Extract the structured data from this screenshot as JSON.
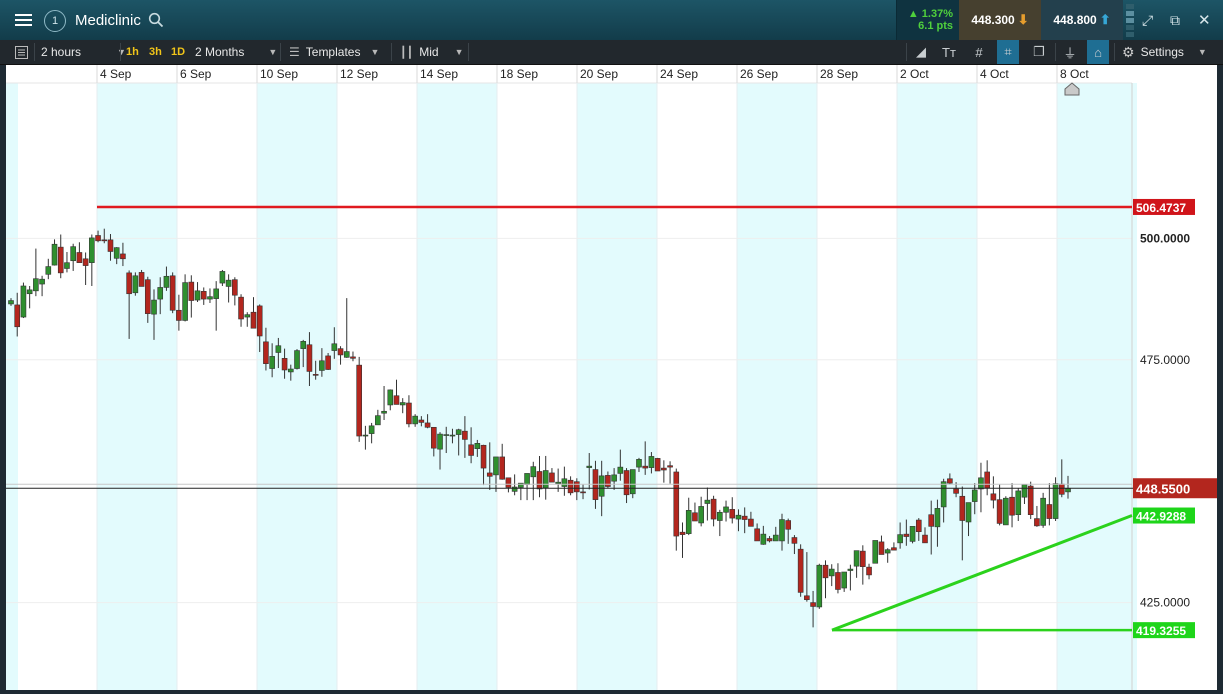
{
  "topbar": {
    "instrument": "Mediclinic",
    "alert_count": "1",
    "change_pct": "▲ 1.37%",
    "change_pts": "6.1 pts",
    "sell_price": "448.300",
    "buy_price": "448.800"
  },
  "toolbar": {
    "interval": "2 hours",
    "quick_1": "1h",
    "quick_2": "3h",
    "quick_3": "1D",
    "range": "2 Months",
    "templates": "Templates",
    "price_type": "Mid",
    "settings": "Settings"
  },
  "colors": {
    "up": "#2f8f2f",
    "down": "#b3261e",
    "resistance": "#e0191f",
    "support": "#2bd21c",
    "band": "#e3fbfd",
    "price_tag": "#b3261e"
  },
  "chart_data": {
    "type": "candlestick",
    "x_tick_labels": [
      "4 Sep",
      "6 Sep",
      "10 Sep",
      "12 Sep",
      "14 Sep",
      "18 Sep",
      "20 Sep",
      "24 Sep",
      "26 Sep",
      "28 Sep",
      "2 Oct",
      "4 Oct",
      "8 Oct"
    ],
    "y_tick_labels": [
      "500.0000",
      "475.0000",
      "425.0000"
    ],
    "y_ticks": [
      500,
      475,
      425
    ],
    "ylim": [
      407,
      532
    ],
    "grid": true,
    "current_price": 448.55,
    "current_price_label": "448.5500",
    "lines": [
      {
        "label": "506.4737",
        "kind": "horizontal",
        "value": 506.4737,
        "color": "resistance"
      },
      {
        "label": "419.3255",
        "kind": "horizontal",
        "value": 419.3255,
        "color": "support"
      },
      {
        "label": "442.9288",
        "kind": "trend",
        "start": 419.3255,
        "end": 442.9288,
        "color": "support"
      }
    ],
    "candles": [
      [
        486.5,
        487.7,
        486.1,
        487.2
      ],
      [
        486.3,
        488.8,
        479.8,
        481.8
      ],
      [
        483.8,
        490.9,
        483.6,
        490.2
      ],
      [
        488.6,
        490.2,
        485.6,
        489.4
      ],
      [
        489.2,
        497.9,
        488.1,
        491.7
      ],
      [
        490.6,
        492.3,
        488.1,
        491.6
      ],
      [
        492.6,
        495.8,
        491.6,
        494.2
      ],
      [
        494.5,
        499.8,
        494.4,
        498.8
      ],
      [
        498.2,
        500.8,
        491.8,
        492.9
      ],
      [
        493.8,
        497.2,
        493.0,
        495.0
      ],
      [
        495.4,
        498.9,
        493.3,
        498.3
      ],
      [
        497.1,
        499.2,
        495.0,
        495.0
      ],
      [
        495.8,
        497.1,
        490.4,
        494.4
      ],
      [
        495.0,
        500.8,
        490.2,
        500.1
      ],
      [
        500.6,
        501.6,
        499.2,
        499.5
      ],
      [
        499.7,
        502.0,
        499.0,
        499.6
      ],
      [
        499.7,
        500.9,
        495.4,
        497.3
      ],
      [
        495.9,
        498.2,
        494.7,
        498.1
      ],
      [
        496.8,
        499.1,
        494.3,
        495.8
      ],
      [
        492.9,
        493.4,
        479.3,
        488.6
      ],
      [
        488.8,
        493.0,
        488.2,
        492.3
      ],
      [
        493.0,
        493.5,
        490.1,
        490.1
      ],
      [
        491.5,
        492.1,
        482.6,
        484.5
      ],
      [
        484.4,
        489.5,
        479.1,
        487.3
      ],
      [
        487.5,
        492.0,
        484.4,
        489.9
      ],
      [
        489.9,
        494.2,
        489.2,
        492.2
      ],
      [
        492.3,
        493.0,
        484.6,
        485.2
      ],
      [
        485.2,
        488.4,
        481.0,
        483.1
      ],
      [
        483.1,
        492.6,
        482.9,
        490.9
      ],
      [
        491.0,
        492.4,
        483.7,
        487.2
      ],
      [
        487.3,
        491.0,
        486.9,
        489.2
      ],
      [
        489.1,
        489.9,
        486.3,
        487.5
      ],
      [
        487.5,
        489.7,
        486.7,
        488.0
      ],
      [
        487.6,
        491.2,
        481.0,
        489.6
      ],
      [
        490.8,
        493.5,
        490.2,
        493.2
      ],
      [
        490.1,
        492.6,
        486.8,
        491.4
      ],
      [
        491.5,
        492.0,
        486.2,
        488.3
      ],
      [
        487.9,
        488.5,
        481.8,
        483.4
      ],
      [
        483.8,
        484.8,
        481.8,
        484.3
      ],
      [
        484.8,
        487.9,
        482.6,
        481.5
      ],
      [
        486.1,
        486.4,
        476.6,
        479.9
      ],
      [
        478.7,
        481.6,
        472.8,
        474.2
      ],
      [
        473.2,
        478.4,
        471.4,
        475.7
      ],
      [
        476.5,
        479.5,
        473.3,
        477.9
      ],
      [
        475.3,
        477.3,
        471.1,
        472.9
      ],
      [
        472.5,
        474.0,
        470.7,
        473.1
      ],
      [
        473.2,
        477.2,
        473.0,
        476.9
      ],
      [
        477.3,
        479.1,
        473.5,
        478.8
      ],
      [
        478.1,
        480.7,
        469.6,
        472.6
      ],
      [
        472.0,
        474.8,
        470.9,
        471.8
      ],
      [
        472.8,
        477.4,
        471.5,
        474.8
      ],
      [
        475.8,
        476.4,
        472.9,
        473.0
      ],
      [
        476.9,
        481.7,
        475.2,
        478.3
      ],
      [
        477.3,
        477.8,
        474.0,
        476.0
      ],
      [
        475.5,
        487.7,
        475.4,
        476.7
      ],
      [
        475.6,
        476.7,
        474.7,
        475.3
      ],
      [
        473.9,
        475.6,
        458.1,
        459.3
      ],
      [
        459.3,
        461.4,
        456.5,
        459.5
      ],
      [
        459.8,
        462.0,
        457.8,
        461.4
      ],
      [
        461.6,
        464.7,
        461.7,
        463.5
      ],
      [
        464.0,
        469.6,
        462.6,
        464.4
      ],
      [
        465.7,
        468.9,
        464.6,
        468.8
      ],
      [
        467.6,
        470.9,
        465.8,
        465.8
      ],
      [
        465.7,
        467.1,
        464.0,
        466.2
      ],
      [
        466.1,
        467.7,
        461.1,
        461.8
      ],
      [
        461.8,
        463.8,
        461.2,
        463.4
      ],
      [
        462.6,
        463.4,
        461.3,
        462.1
      ],
      [
        462.0,
        463.8,
        460.9,
        461.1
      ],
      [
        461.1,
        461.1,
        455.1,
        456.8
      ],
      [
        456.6,
        460.1,
        452.4,
        459.7
      ],
      [
        459.6,
        461.2,
        455.8,
        459.6
      ],
      [
        459.3,
        460.8,
        457.8,
        459.5
      ],
      [
        459.6,
        460.8,
        455.3,
        460.6
      ],
      [
        460.3,
        463.4,
        454.8,
        458.6
      ],
      [
        457.5,
        461.1,
        453.7,
        455.3
      ],
      [
        456.7,
        458.5,
        455.0,
        457.8
      ],
      [
        457.4,
        457.5,
        449.2,
        452.7
      ],
      [
        451.7,
        458.0,
        448.2,
        451.0
      ],
      [
        451.3,
        454.1,
        447.8,
        455.0
      ],
      [
        455.0,
        457.7,
        450.3,
        450.4
      ],
      [
        450.7,
        450.6,
        447.7,
        448.7
      ],
      [
        447.9,
        451.4,
        447.1,
        448.8
      ],
      [
        448.7,
        449.4,
        446.1,
        449.6
      ],
      [
        449.3,
        451.4,
        446.1,
        451.6
      ],
      [
        450.9,
        454.0,
        446.1,
        453.0
      ],
      [
        452.0,
        455.2,
        446.7,
        448.4
      ],
      [
        448.6,
        455.2,
        446.2,
        452.2
      ],
      [
        451.7,
        452.7,
        451.5,
        449.8
      ],
      [
        449.5,
        452.6,
        447.8,
        449.8
      ],
      [
        448.9,
        453.0,
        447.0,
        450.5
      ],
      [
        450.2,
        451.0,
        447.1,
        447.6
      ],
      [
        449.9,
        450.6,
        446.1,
        447.8
      ],
      [
        447.8,
        449.3,
        446.3,
        447.6
      ],
      [
        452.8,
        455.8,
        448.3,
        453.1
      ],
      [
        452.4,
        454.2,
        444.3,
        446.2
      ],
      [
        446.9,
        454.2,
        442.8,
        451.1
      ],
      [
        451.2,
        452.0,
        448.6,
        448.9
      ],
      [
        450.0,
        452.7,
        448.2,
        451.3
      ],
      [
        451.6,
        456.5,
        450.1,
        452.9
      ],
      [
        452.2,
        452.7,
        445.5,
        447.2
      ],
      [
        447.4,
        450.6,
        446.5,
        452.4
      ],
      [
        452.9,
        454.8,
        451.9,
        454.5
      ],
      [
        453.1,
        458.2,
        451.3,
        452.7
      ],
      [
        452.8,
        456.0,
        451.6,
        455.1
      ],
      [
        454.7,
        454.8,
        452.1,
        452.1
      ],
      [
        452.7,
        454.3,
        449.7,
        452.3
      ],
      [
        453.2,
        454.1,
        449.5,
        452.9
      ],
      [
        451.9,
        452.6,
        435.7,
        438.7
      ],
      [
        439.5,
        441.5,
        434.2,
        439.0
      ],
      [
        439.2,
        446.6,
        438.9,
        444.0
      ],
      [
        443.5,
        445.6,
        441.8,
        441.8
      ],
      [
        441.4,
        446.8,
        440.7,
        444.8
      ],
      [
        445.4,
        448.7,
        441.9,
        446.1
      ],
      [
        446.3,
        447.0,
        440.7,
        442.2
      ],
      [
        441.9,
        444.1,
        438.7,
        443.6
      ],
      [
        443.6,
        446.0,
        441.7,
        444.7
      ],
      [
        444.2,
        446.7,
        441.3,
        442.4
      ],
      [
        442.2,
        444.2,
        439.7,
        443.0
      ],
      [
        442.8,
        444.6,
        439.3,
        442.1
      ],
      [
        442.2,
        443.7,
        440.7,
        440.7
      ],
      [
        440.2,
        441.3,
        437.8,
        437.7
      ],
      [
        437.0,
        440.8,
        436.9,
        439.1
      ],
      [
        438.2,
        438.7,
        437.4,
        437.7
      ],
      [
        437.7,
        440.6,
        437.9,
        438.9
      ],
      [
        437.7,
        443.3,
        435.7,
        442.1
      ],
      [
        441.9,
        442.3,
        437.1,
        440.1
      ],
      [
        438.4,
        438.9,
        435.0,
        437.2
      ],
      [
        436.0,
        437.0,
        426.2,
        427.1
      ],
      [
        426.4,
        435.4,
        425.2,
        425.6
      ],
      [
        425.0,
        427.4,
        419.9,
        424.2
      ],
      [
        424.1,
        433.0,
        423.7,
        432.7
      ],
      [
        432.7,
        433.7,
        425.9,
        430.1
      ],
      [
        430.5,
        432.9,
        428.4,
        431.9
      ],
      [
        431.2,
        433.1,
        426.9,
        427.7
      ],
      [
        428.0,
        430.2,
        427.2,
        431.3
      ],
      [
        431.6,
        432.8,
        427.5,
        431.9
      ],
      [
        432.5,
        434.3,
        430.1,
        435.7
      ],
      [
        435.6,
        436.8,
        428.7,
        432.4
      ],
      [
        432.3,
        433.0,
        429.8,
        430.7
      ],
      [
        433.1,
        434.6,
        433.7,
        437.8
      ],
      [
        437.5,
        438.8,
        435.7,
        434.9
      ],
      [
        435.2,
        436.2,
        433.2,
        435.9
      ],
      [
        436.3,
        437.4,
        436.3,
        435.8
      ],
      [
        437.3,
        441.5,
        436.1,
        439.0
      ],
      [
        439.1,
        442.1,
        436.7,
        438.6
      ],
      [
        437.6,
        440.3,
        437.2,
        440.7
      ],
      [
        442.0,
        442.4,
        437.7,
        439.6
      ],
      [
        438.9,
        440.5,
        437.3,
        437.3
      ],
      [
        443.1,
        446.0,
        434.9,
        440.7
      ],
      [
        440.6,
        446.2,
        436.5,
        444.4
      ],
      [
        444.7,
        450.5,
        441.5,
        449.9
      ],
      [
        450.5,
        451.6,
        449.3,
        449.6
      ],
      [
        448.4,
        449.8,
        446.7,
        447.5
      ],
      [
        446.9,
        448.9,
        433.7,
        441.9
      ],
      [
        441.6,
        444.8,
        438.7,
        445.6
      ],
      [
        445.8,
        449.6,
        443.2,
        448.2
      ],
      [
        448.4,
        453.8,
        443.6,
        450.7
      ],
      [
        451.9,
        454.3,
        447.1,
        448.6
      ],
      [
        447.4,
        451.0,
        444.4,
        446.1
      ],
      [
        446.2,
        449.3,
        440.9,
        441.3
      ],
      [
        441.0,
        446.9,
        441.7,
        446.5
      ],
      [
        446.7,
        449.6,
        440.5,
        443.0
      ],
      [
        443.1,
        448.6,
        441.8,
        448.0
      ],
      [
        446.7,
        449.0,
        445.3,
        449.3
      ],
      [
        449.0,
        449.9,
        442.2,
        443.1
      ],
      [
        442.3,
        444.9,
        440.6,
        440.8
      ],
      [
        440.9,
        447.6,
        440.4,
        446.5
      ],
      [
        445.2,
        449.6,
        440.9,
        442.3
      ],
      [
        442.3,
        450.8,
        441.8,
        449.5
      ],
      [
        449.4,
        454.5,
        446.7,
        447.3
      ],
      [
        447.8,
        451.1,
        446.4,
        448.5
      ]
    ]
  }
}
